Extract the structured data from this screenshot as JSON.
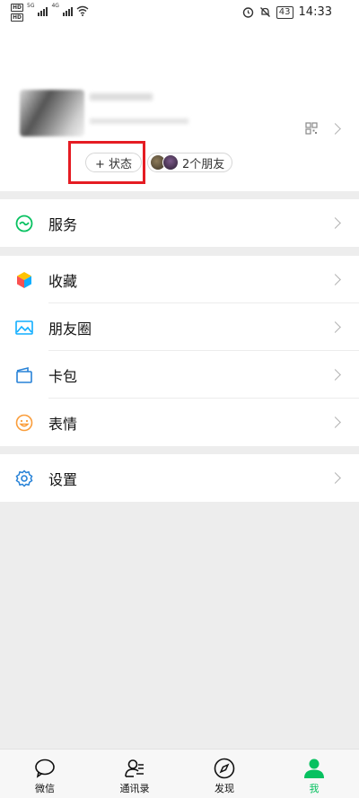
{
  "status_bar": {
    "hd1": "HD",
    "hd2": "HD",
    "net1": "5G",
    "net2": "4G",
    "battery": "43",
    "time": "14:33"
  },
  "profile": {
    "status_button": "+ 状态",
    "friends_button": "2个朋友"
  },
  "menu": {
    "services": "服务",
    "favorites": "收藏",
    "moments": "朋友圈",
    "cards": "卡包",
    "stickers": "表情",
    "settings": "设置"
  },
  "tabs": [
    {
      "label": "微信",
      "icon": "chat-bubble-icon"
    },
    {
      "label": "通讯录",
      "icon": "contacts-icon"
    },
    {
      "label": "发现",
      "icon": "compass-icon"
    },
    {
      "label": "我",
      "icon": "person-icon"
    }
  ],
  "colors": {
    "accent": "#07c160",
    "highlight": "#e51c23",
    "background": "#ededed"
  }
}
